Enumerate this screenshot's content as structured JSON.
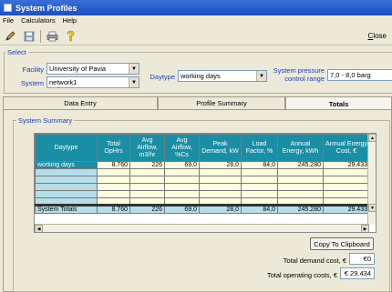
{
  "window": {
    "title": "System Profiles"
  },
  "menu": [
    "File",
    "Calculators",
    "Help"
  ],
  "toolbar": {
    "close_label_prefix": "C",
    "close_label_rest": "lose"
  },
  "select": {
    "legend": "Select",
    "facility_label": "Facility",
    "facility_value": "University of Pavia",
    "system_label": "System",
    "system_value": "network1",
    "daytype_label": "Daytype",
    "daytype_value": "working days",
    "pressure_label_1": "System pressure",
    "pressure_label_2": "control range",
    "pressure_value": "7,0 - 8,0 barg"
  },
  "tabs": [
    {
      "label": "Data Entry"
    },
    {
      "label": "Profile Summary"
    },
    {
      "label": "Totals"
    }
  ],
  "summary": {
    "legend": "System Summary",
    "columns": [
      "Daytype",
      "Total OpHrs",
      "Avg Airflow, m3/hr",
      "Avg Airflow, %Cs",
      "Peak Demand, kW",
      "Load Factor, %",
      "Annual Energy, kWh",
      "Annual Energy Cost, €"
    ],
    "rows": [
      [
        "working days",
        "8.760",
        "226",
        "69,0",
        "28,0",
        "84,0",
        "245.280",
        "29.433"
      ]
    ],
    "totals": [
      "System Totals",
      "8.760",
      "226",
      "69,0",
      "28,0",
      "84,0",
      "245.280",
      "29.433"
    ]
  },
  "copy_label": "Copy To Clipboard",
  "footer": {
    "demand_label": "Total demand cost, €",
    "demand_value": "€0",
    "operating_label": "Total operating costs, €",
    "operating_value": "€ 29.434"
  }
}
